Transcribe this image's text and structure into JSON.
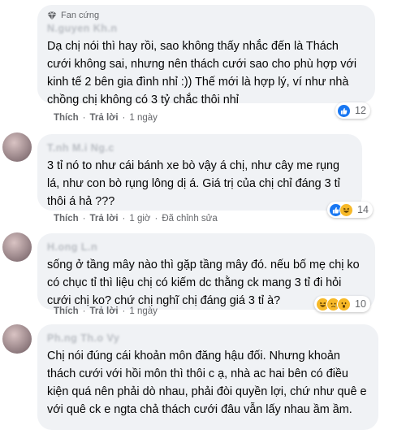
{
  "comments": [
    {
      "badge": "Fan cứng",
      "text": "Dạ chị nói thì hay rồi, sao không thấy nhắc đến là Thách cưới không sai, nhưng nên thách cưới sao cho phù hợp với kinh tế 2 bên gia đình nhỉ :)) Thế mới là hợp lý, ví như nhà chồng chị không có 3 tỷ chắc thôi nhỉ",
      "like_label": "Thích",
      "reply_label": "Trả lời",
      "time": "1 ngày",
      "edited": "",
      "reaction_icons": [
        "like-reaction-icon"
      ],
      "reaction_count": "12"
    },
    {
      "text": "3 tỉ nó to như cái bánh xe bò vậy á chị, như cây me rụng lá, như con bò rụng lông dị á. Giá trị của chị chỉ đáng 3 tỉ thôi á hả ???",
      "like_label": "Thích",
      "reply_label": "Trả lời",
      "time": "1 giờ",
      "edited": "Đã chỉnh sửa",
      "reaction_icons": [
        "like-reaction-icon",
        "haha-reaction-icon"
      ],
      "reaction_count": "14"
    },
    {
      "text": "sống ở tầng mây nào thì gặp tầng mây đó. nếu bố mẹ chị ko có chục tỉ thì liệu chị có kiếm dc thằng ck mang 3 tỉ đi hỏi cưới chị ko? chứ chị nghĩ chị đáng giá 3 tỉ à?",
      "like_label": "Thích",
      "reply_label": "Trả lời",
      "time": "1 ngày",
      "edited": "",
      "reaction_icons": [
        "haha-reaction-icon",
        "sad-reaction-icon",
        "wow-reaction-icon"
      ],
      "reaction_count": "10"
    },
    {
      "text": "Chị nói đúng cái khoản môn đăng hậu đối. Nhưng khoản thách cưới với hồi môn thì thôi c ạ, nhà ac hai bên có điều kiện quá nên phải dò nhau, phải đòi quyền lợi, chứ như quê e với quê ck e ngta chả thách cưới đâu vẫn lấy nhau ầm ầm."
    }
  ],
  "colors": {
    "bubble": "#f0f2f5",
    "meta_text": "#65676b",
    "like_blue": "#1877f2",
    "emoji_yellow": "#f7b928"
  }
}
